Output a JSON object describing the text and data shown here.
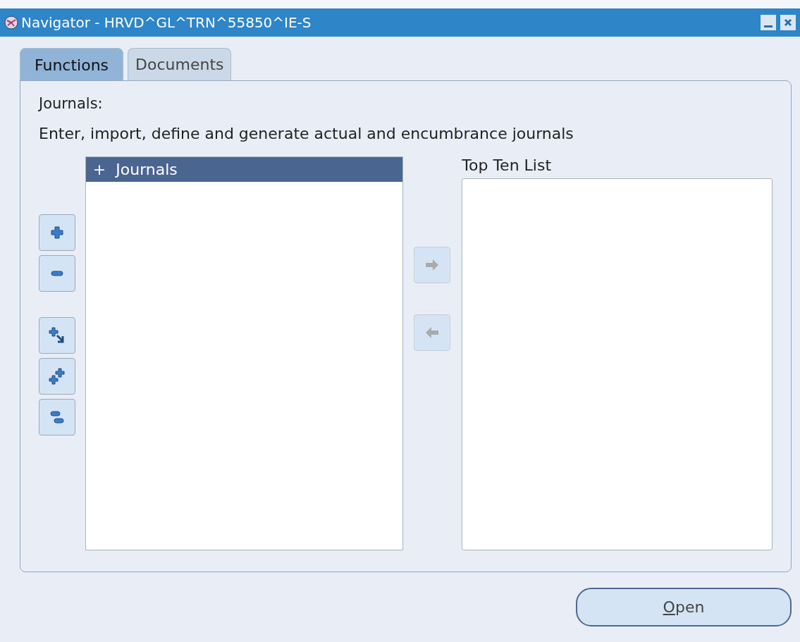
{
  "window": {
    "title": "Navigator - HRVD^GL^TRN^55850^IE-S"
  },
  "tabs": [
    {
      "label": "Functions",
      "selected": true
    },
    {
      "label": "Documents",
      "selected": false
    }
  ],
  "heading": "Journals:",
  "description": "Enter, import, define and generate actual and encumbrance journals",
  "tree_tools": [
    {
      "kind": "expand"
    },
    {
      "kind": "collapse"
    },
    {
      "kind": "expand-branch"
    },
    {
      "kind": "expand-all"
    },
    {
      "kind": "collapse-all"
    }
  ],
  "tree": {
    "items": [
      {
        "marker": "+",
        "label": "Journals",
        "selected": true
      }
    ]
  },
  "transfer_buttons": [
    {
      "kind": "add",
      "disabled": true
    },
    {
      "kind": "remove",
      "disabled": true
    }
  ],
  "top_ten": {
    "label": "Top Ten List"
  },
  "open_button": {
    "label": "Open"
  }
}
